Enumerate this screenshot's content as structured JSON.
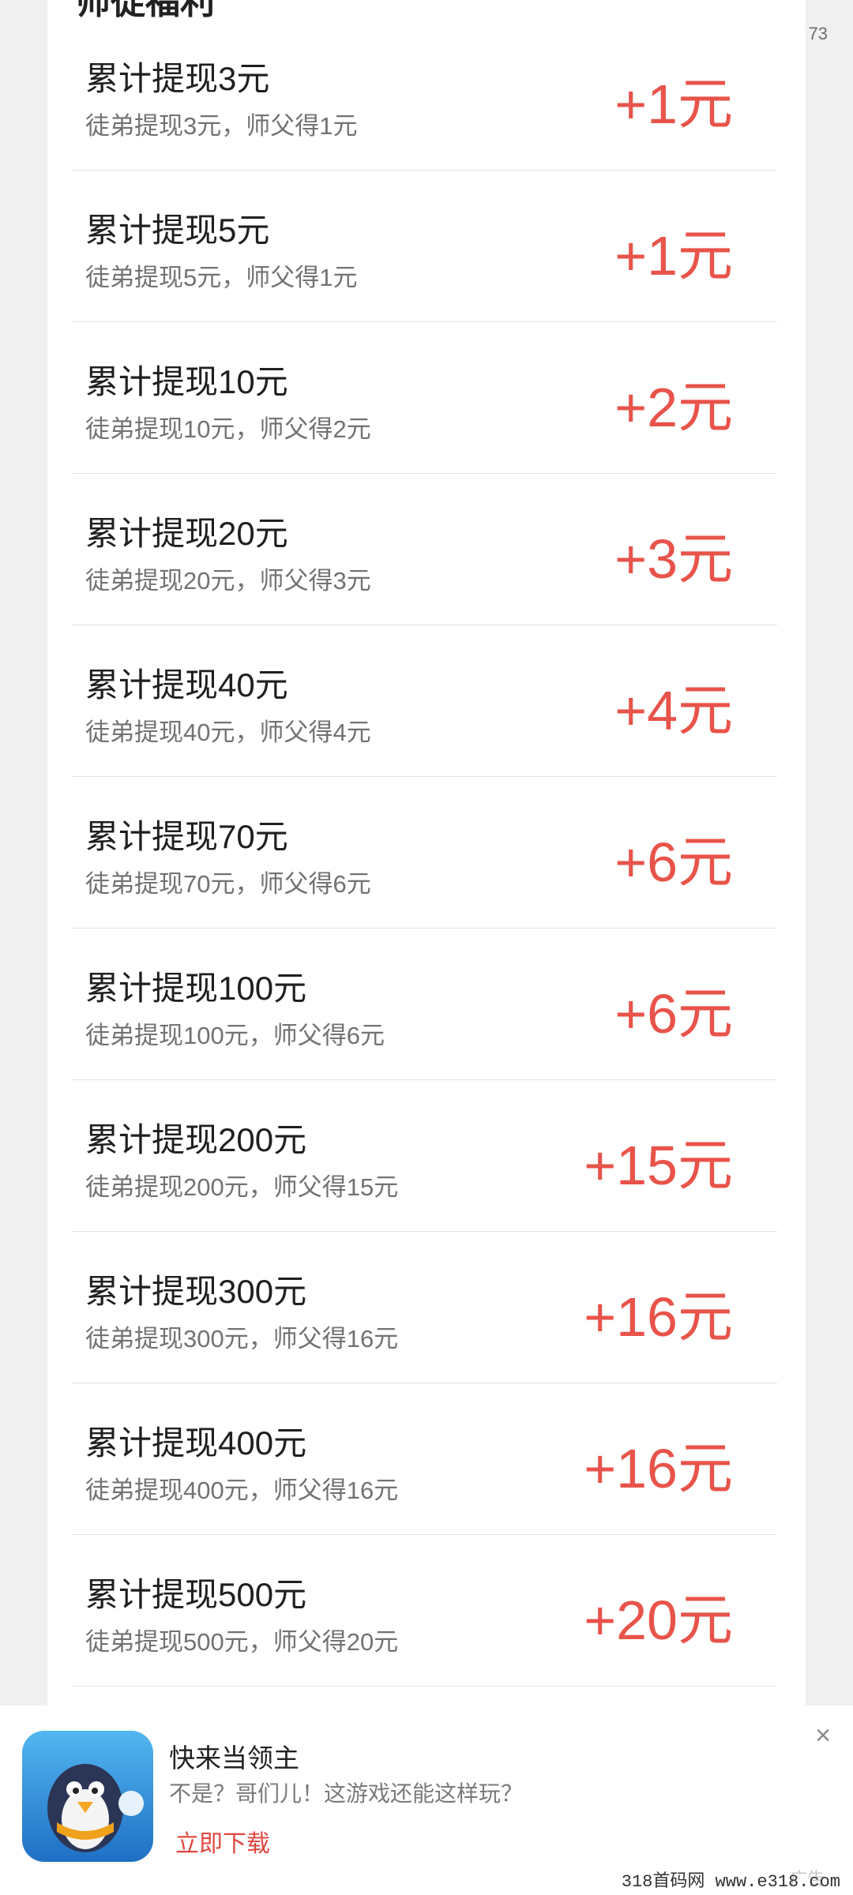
{
  "header": {
    "section_title": "师徒福利",
    "page_counter": "73"
  },
  "rewards": [
    {
      "title": "累计提现3元",
      "desc": "徒弟提现3元，师父得1元",
      "reward": "+1元"
    },
    {
      "title": "累计提现5元",
      "desc": "徒弟提现5元，师父得1元",
      "reward": "+1元"
    },
    {
      "title": "累计提现10元",
      "desc": "徒弟提现10元，师父得2元",
      "reward": "+2元"
    },
    {
      "title": "累计提现20元",
      "desc": "徒弟提现20元，师父得3元",
      "reward": "+3元"
    },
    {
      "title": "累计提现40元",
      "desc": "徒弟提现40元，师父得4元",
      "reward": "+4元"
    },
    {
      "title": "累计提现70元",
      "desc": "徒弟提现70元，师父得6元",
      "reward": "+6元"
    },
    {
      "title": "累计提现100元",
      "desc": "徒弟提现100元，师父得6元",
      "reward": "+6元"
    },
    {
      "title": "累计提现200元",
      "desc": "徒弟提现200元，师父得15元",
      "reward": "+15元"
    },
    {
      "title": "累计提现300元",
      "desc": "徒弟提现300元，师父得16元",
      "reward": "+16元"
    },
    {
      "title": "累计提现400元",
      "desc": "徒弟提现400元，师父得16元",
      "reward": "+16元"
    },
    {
      "title": "累计提现500元",
      "desc": "徒弟提现500元，师父得20元",
      "reward": "+20元"
    }
  ],
  "ad": {
    "title": "快来当领主",
    "desc": "不是？哥们儿！这游戏还能这样玩？",
    "cta": "立即下载",
    "label": "广告",
    "close_icon": "close-icon"
  },
  "watermark": "318首码网  www.e318.com",
  "colors": {
    "accent": "#e8534a",
    "title_underline": "#ffcc33"
  }
}
